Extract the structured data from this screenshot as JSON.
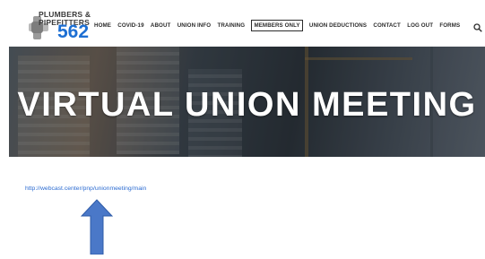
{
  "logo": {
    "line1": "PLUMBERS &",
    "line2": "PIPEFITTERS",
    "number": "562"
  },
  "nav": {
    "items": [
      {
        "label": "HOME"
      },
      {
        "label": "COVID-19"
      },
      {
        "label": "ABOUT"
      },
      {
        "label": "UNION INFO"
      },
      {
        "label": "TRAINING"
      },
      {
        "label": "MEMBERS ONLY",
        "active": true
      },
      {
        "label": "UNION DEDUCTIONS"
      },
      {
        "label": "CONTACT"
      },
      {
        "label": "LOG OUT"
      },
      {
        "label": "FORMS"
      }
    ],
    "search_icon": "search-icon"
  },
  "hero": {
    "title": "VIRTUAL UNION MEETING"
  },
  "link": {
    "text": "http://webcast.center/pnp/unionmeeting/main"
  },
  "colors": {
    "accent": "#1d6fd3",
    "link": "#2b6bd1",
    "arrow": "#4a78c8"
  }
}
